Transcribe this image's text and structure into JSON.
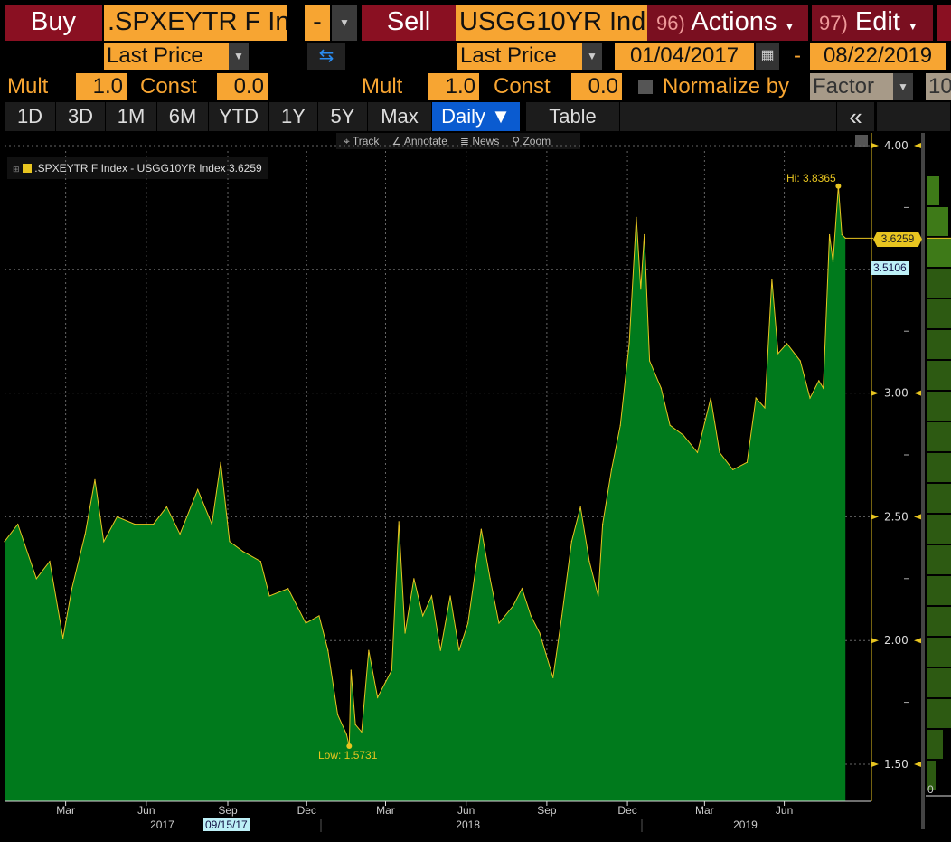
{
  "header": {
    "buy_label": "Buy",
    "buy_ticker": ".SPXEYTR F In",
    "op": "-",
    "sell_label": "Sell",
    "sell_ticker": "USGG10YR Ind",
    "actions_num": "96)",
    "actions": "Actions",
    "edit_num": "97)",
    "edit": "Edit"
  },
  "fields": {
    "field1": "Last Price",
    "field2": "Last Price",
    "start_date": "01/04/2017",
    "date_sep": "-",
    "end_date": "08/22/2019"
  },
  "params": {
    "mult_label": "Mult",
    "const_label": "Const",
    "mult1": "1.0",
    "const1": "0.0",
    "mult2": "1.0",
    "const2": "0.0",
    "normalize_label": "Normalize by",
    "normalize_mode": "Factor",
    "normalize_value": "10"
  },
  "toolbar": {
    "ranges": [
      "1D",
      "3D",
      "1M",
      "6M",
      "YTD",
      "1Y",
      "5Y",
      "Max"
    ],
    "period": "Daily ▼",
    "table": "Table",
    "collapse": "«"
  },
  "chart_tools": [
    "Track",
    "Annotate",
    "News",
    "Zoom"
  ],
  "colors": {
    "fill": "#007a1c",
    "line": "#e8c520",
    "accent": "#f7a532",
    "active": "#0a5bd0"
  },
  "chart_data": {
    "type": "area",
    "title": "",
    "legend": ".SPXEYTR F Index - USGG10YR Index 3.6259",
    "legend_placement": "top-left",
    "xlabel": "",
    "ylabel": "",
    "x_unit": "days since 01/04/2017",
    "xlim": [
      0,
      990
    ],
    "ylim": [
      1.38,
      4.08
    ],
    "y_ticks": [
      "4.00",
      "3.00",
      "2.50",
      "2.00",
      "1.50"
    ],
    "x_ticks": [
      {
        "label": "Mar",
        "d": 69
      },
      {
        "label": "Jun",
        "d": 160
      },
      {
        "label": "Sep",
        "d": 252
      },
      {
        "label": "Dec",
        "d": 341
      },
      {
        "label": "Mar",
        "d": 430
      },
      {
        "label": "Jun",
        "d": 521
      },
      {
        "label": "Sep",
        "d": 612
      },
      {
        "label": "Dec",
        "d": 703
      },
      {
        "label": "Mar",
        "d": 790
      },
      {
        "label": "Jun",
        "d": 880
      }
    ],
    "year_labels": [
      {
        "label": "2017",
        "d": 178
      },
      {
        "label": "2018",
        "d": 523
      },
      {
        "label": "2019",
        "d": 836
      }
    ],
    "cursor_date": "09/15/17",
    "last_value": "3.6259",
    "ref_value": "3.5106",
    "hi_label": "Hi: 3.8365",
    "hi": {
      "d": 941,
      "v": 3.8365
    },
    "low_label": "Low: 1.5731",
    "low": {
      "d": 389,
      "v": 1.5731
    },
    "x": [
      0,
      15,
      36,
      51,
      66,
      76,
      91,
      102,
      112,
      127,
      147,
      168,
      183,
      198,
      218,
      234,
      244,
      254,
      269,
      289,
      299,
      320,
      340,
      355,
      365,
      376,
      386,
      389,
      391,
      396,
      403,
      411,
      421,
      437,
      445,
      452,
      462,
      472,
      482,
      492,
      503,
      513,
      523,
      538,
      548,
      558,
      574,
      584,
      594,
      604,
      619,
      629,
      640,
      650,
      660,
      670,
      675,
      685,
      695,
      705,
      713,
      718,
      722,
      728,
      741,
      751,
      766,
      782,
      797,
      807,
      822,
      838,
      848,
      858,
      866,
      873,
      883,
      898,
      909,
      919,
      924,
      931,
      935,
      941,
      945,
      949
    ],
    "values": [
      2.4,
      2.47,
      2.25,
      2.32,
      2.01,
      2.21,
      2.43,
      2.65,
      2.4,
      2.5,
      2.47,
      2.47,
      2.54,
      2.43,
      2.61,
      2.47,
      2.72,
      2.4,
      2.36,
      2.32,
      2.18,
      2.21,
      2.07,
      2.1,
      1.96,
      1.7,
      1.62,
      1.5731,
      1.88,
      1.66,
      1.63,
      1.96,
      1.77,
      1.88,
      2.48,
      2.03,
      2.25,
      2.1,
      2.18,
      1.96,
      2.18,
      1.96,
      2.07,
      2.45,
      2.25,
      2.07,
      2.14,
      2.21,
      2.1,
      2.03,
      1.85,
      2.1,
      2.4,
      2.54,
      2.32,
      2.18,
      2.47,
      2.69,
      2.87,
      3.2,
      3.71,
      3.42,
      3.64,
      3.13,
      3.02,
      2.87,
      2.83,
      2.76,
      2.98,
      2.76,
      2.69,
      2.72,
      2.98,
      2.94,
      3.46,
      3.16,
      3.2,
      3.13,
      2.98,
      3.05,
      3.02,
      3.64,
      3.53,
      3.8365,
      3.64,
      3.6259
    ]
  }
}
